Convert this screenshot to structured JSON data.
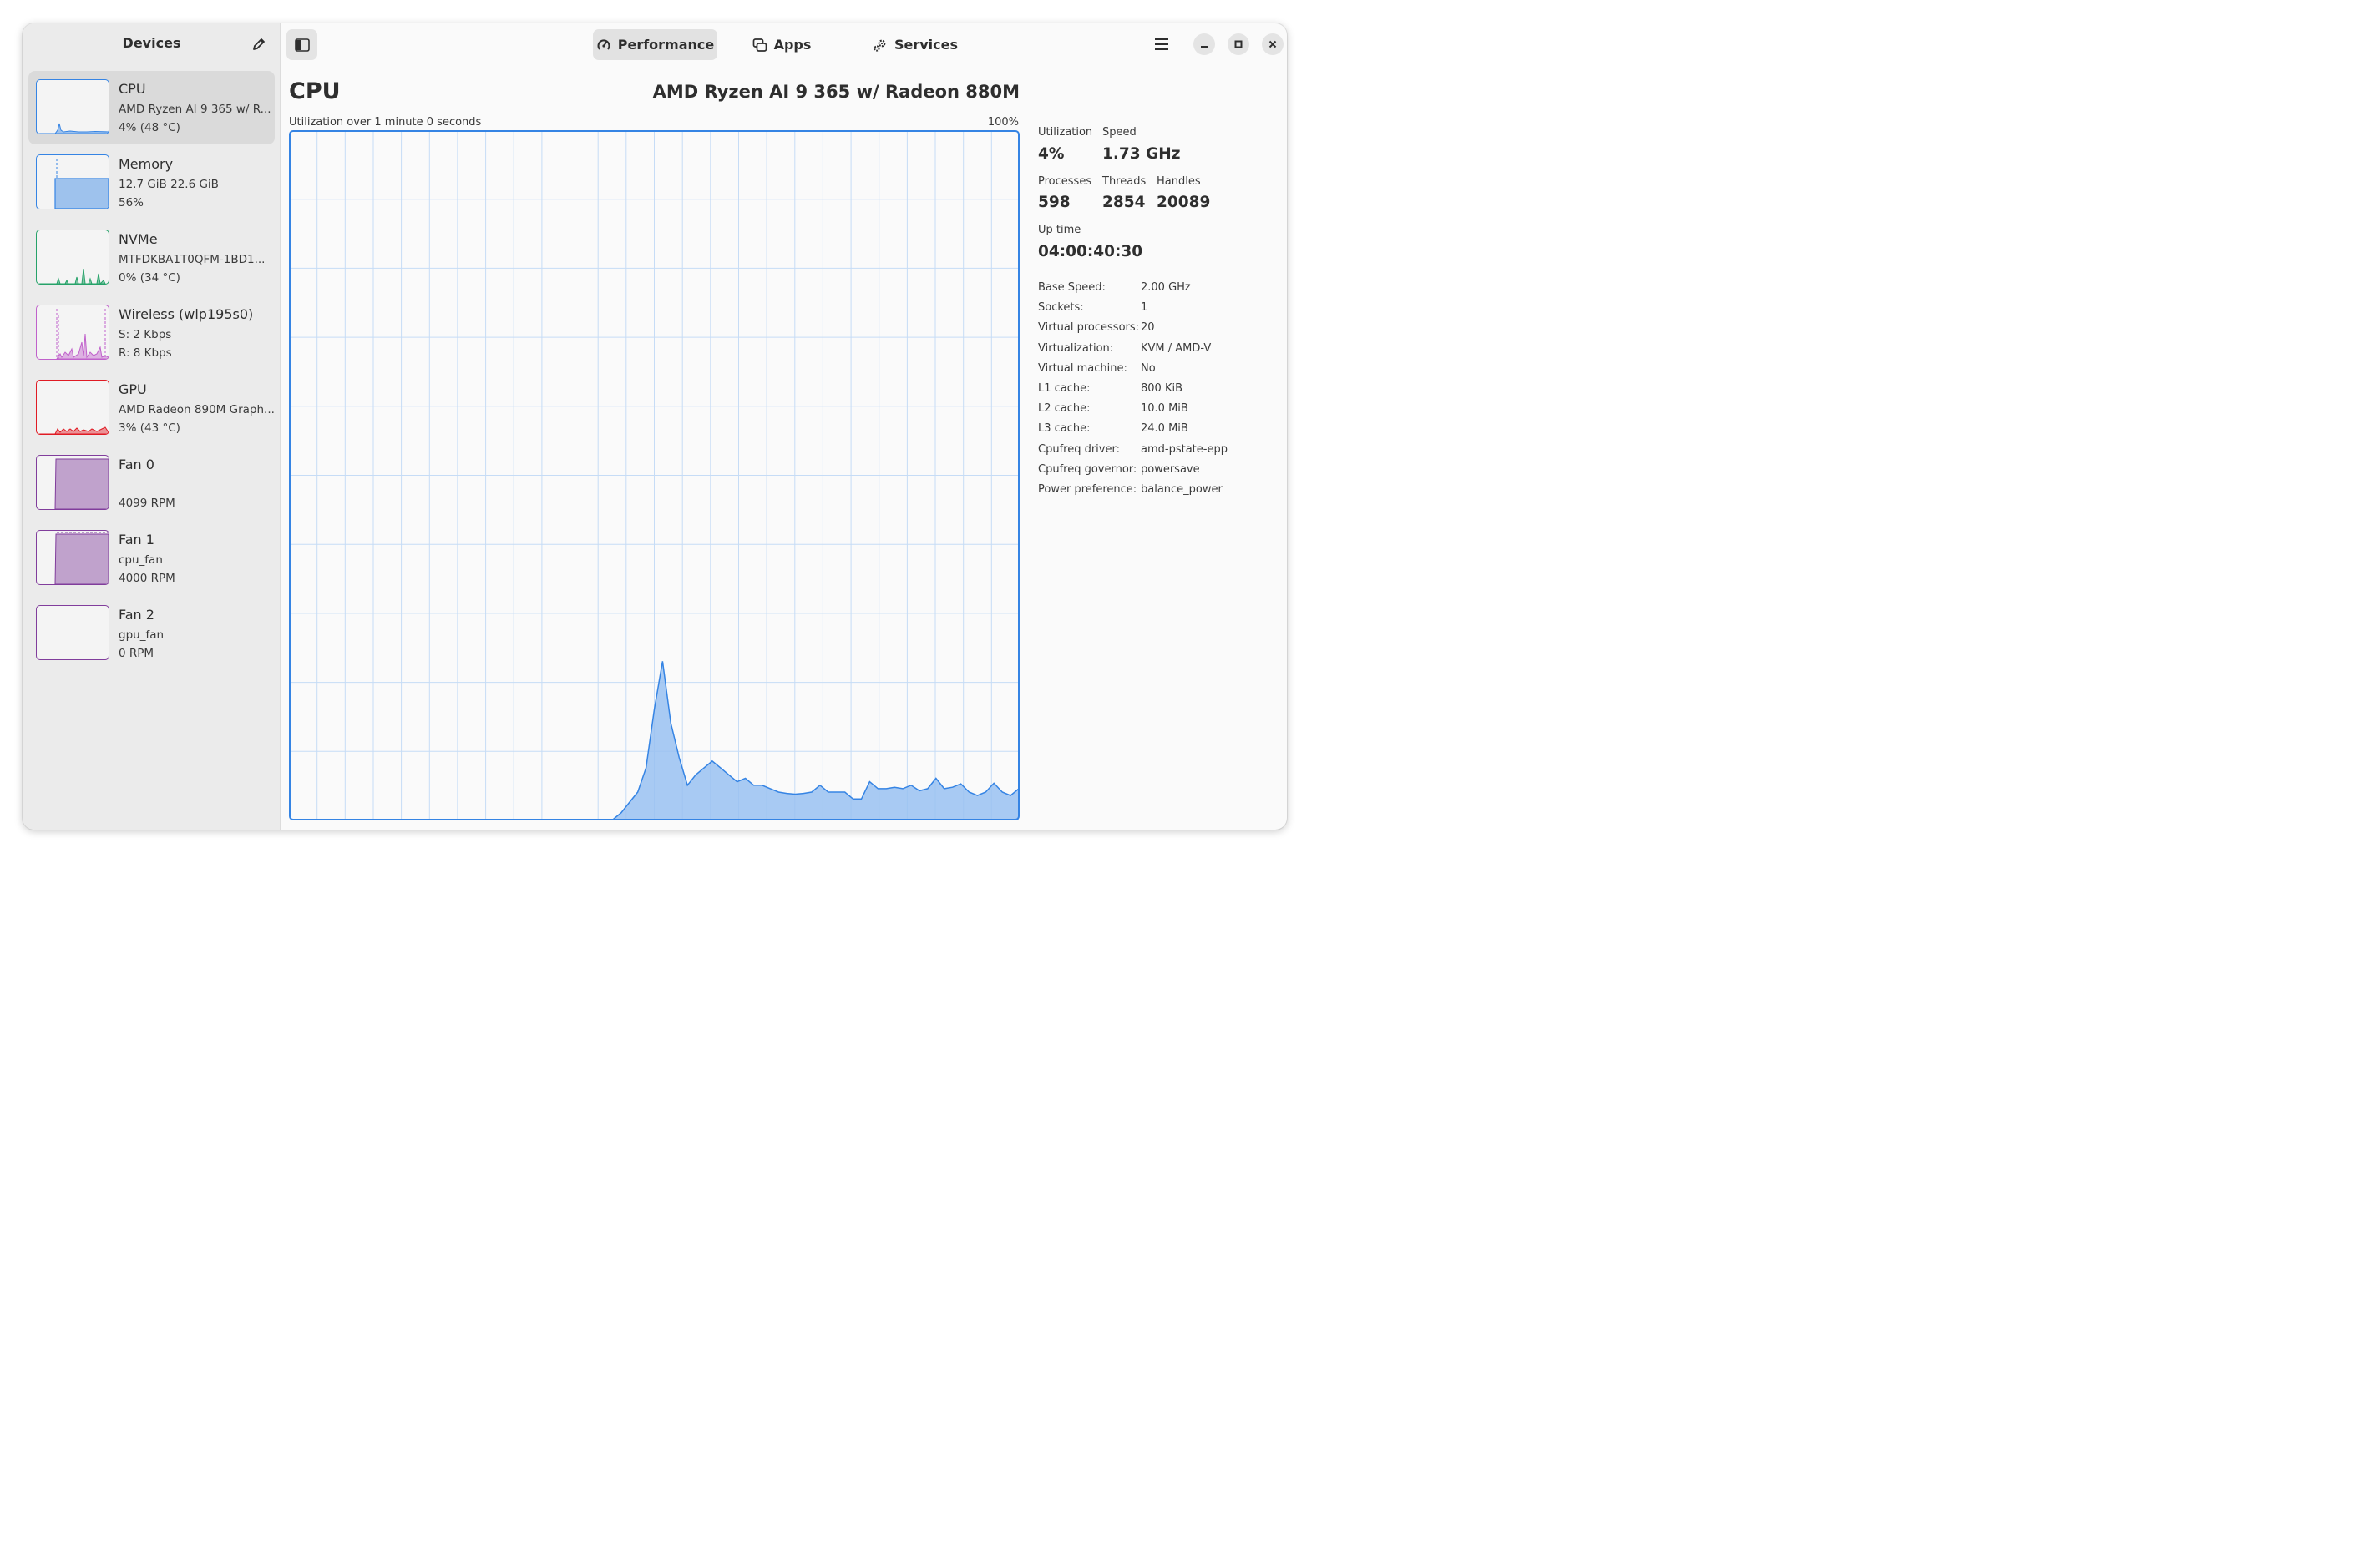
{
  "sidebar": {
    "title": "Devices",
    "devices": [
      {
        "name": "CPU",
        "line1": "AMD Ryzen AI 9 365 w/ R...",
        "line2": "4% (48 °C)",
        "color": "#3584e4"
      },
      {
        "name": "Memory",
        "line1": "12.7 GiB 22.6 GiB",
        "line2": "56%",
        "color": "#3584e4"
      },
      {
        "name": "NVMe",
        "line1": "MTFDKBA1T0QFM-1BD1...",
        "line2": "0% (34 °C)",
        "color": "#26a269"
      },
      {
        "name": "Wireless (wlp195s0)",
        "line1": "S: 2 Kbps",
        "line2": "R: 8 Kbps",
        "color": "#c061cb"
      },
      {
        "name": "GPU",
        "line1": "AMD Radeon 890M Graph...",
        "line2": "3% (43 °C)",
        "color": "#e01b24"
      },
      {
        "name": "Fan 0",
        "line1": "",
        "line2": "4099 RPM",
        "color": "#813d9c"
      },
      {
        "name": "Fan 1",
        "line1": "cpu_fan",
        "line2": "4000 RPM",
        "color": "#813d9c"
      },
      {
        "name": "Fan 2",
        "line1": "gpu_fan",
        "line2": "0 RPM",
        "color": "#813d9c"
      }
    ]
  },
  "header": {
    "tabs": [
      {
        "label": "Performance",
        "icon": "gauge-icon",
        "active": true
      },
      {
        "label": "Apps",
        "icon": "windows-icon",
        "active": false
      },
      {
        "label": "Services",
        "icon": "gears-icon",
        "active": false
      }
    ]
  },
  "main": {
    "title": "CPU",
    "model": "AMD Ryzen AI 9 365 w/ Radeon 880M",
    "graph_caption": "Utilization over 1 minute 0 seconds",
    "graph_max": "100%",
    "stats": {
      "utilization_label": "Utilization",
      "utilization": "4%",
      "speed_label": "Speed",
      "speed": "1.73 GHz",
      "processes_label": "Processes",
      "processes": "598",
      "threads_label": "Threads",
      "threads": "2854",
      "handles_label": "Handles",
      "handles": "20089",
      "uptime_label": "Up time",
      "uptime": "04:00:40:30"
    },
    "details": [
      {
        "key": "Base Speed:",
        "value": "2.00 GHz"
      },
      {
        "key": "Sockets:",
        "value": "1"
      },
      {
        "key": "Virtual processors:",
        "value": "20"
      },
      {
        "key": "Virtualization:",
        "value": "KVM / AMD-V"
      },
      {
        "key": "Virtual machine:",
        "value": "No"
      },
      {
        "key": "L1 cache:",
        "value": "800 KiB"
      },
      {
        "key": "L2 cache:",
        "value": "10.0 MiB"
      },
      {
        "key": "L3 cache:",
        "value": "24.0 MiB"
      },
      {
        "key": "Cpufreq driver:",
        "value": "amd-pstate-epp"
      },
      {
        "key": "Cpufreq governor:",
        "value": "powersave"
      },
      {
        "key": "Power preference:",
        "value": "balance_power"
      }
    ]
  },
  "chart_data": {
    "type": "area",
    "ylim": [
      0,
      100
    ],
    "y_max_label": "100%",
    "series": [
      {
        "values": [
          0,
          0,
          0,
          0,
          0,
          0,
          0,
          0,
          0,
          0,
          0,
          0,
          0,
          0,
          0,
          0,
          0,
          0,
          0,
          0,
          0,
          0,
          0,
          0,
          0,
          0,
          0,
          0,
          0,
          0,
          0,
          0,
          0,
          0,
          0,
          0,
          0,
          0,
          0,
          0,
          1,
          2.5,
          4,
          7.5,
          16,
          23,
          14,
          9,
          5,
          6.5,
          7.5,
          8.5,
          7.5,
          6.5,
          5.5,
          6,
          5,
          5,
          4.5,
          4,
          3.8,
          3.7,
          3.8,
          4,
          5,
          4,
          4,
          4,
          3,
          3,
          5.5,
          4.5,
          4.5,
          4.7,
          4.5,
          5,
          4.2,
          4.5,
          6,
          4.5,
          4.7,
          5.2,
          4,
          3.5,
          4,
          5.3,
          4,
          3.5,
          4.5
        ]
      }
    ]
  }
}
